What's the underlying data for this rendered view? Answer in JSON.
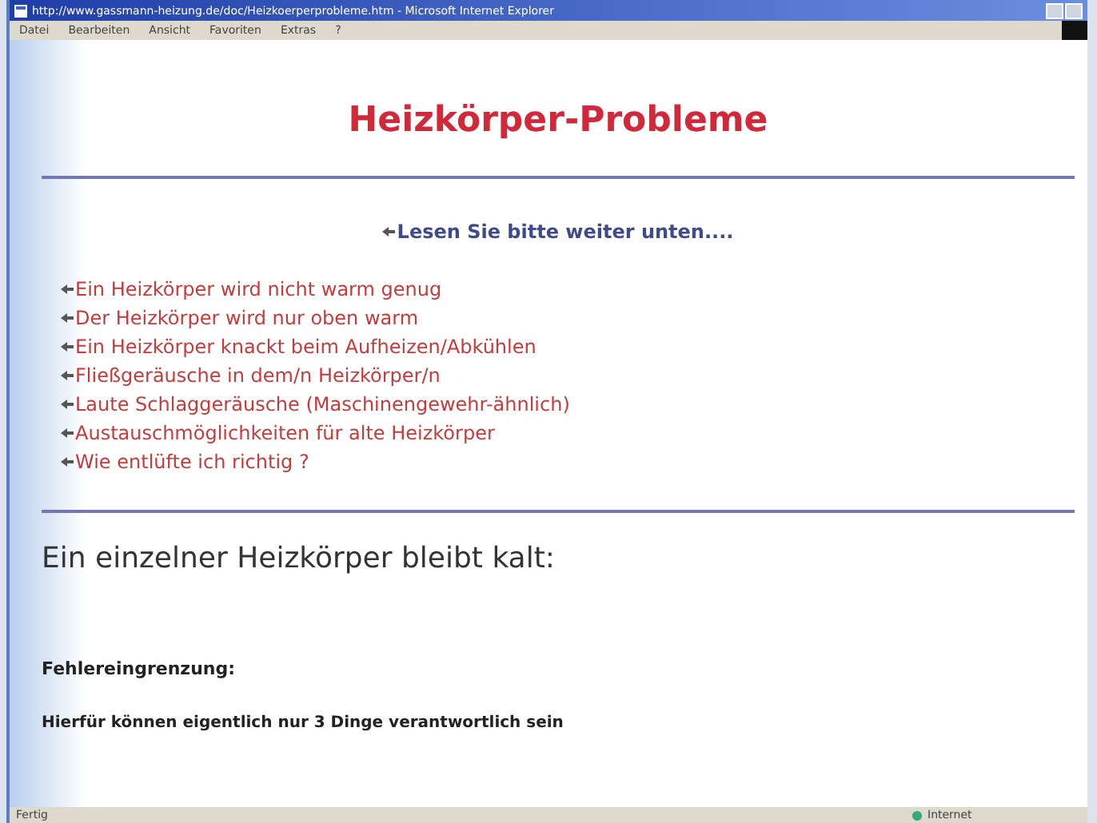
{
  "window": {
    "title": "http://www.gassmann-heizung.de/doc/Heizkoerperprobleme.htm - Microsoft Internet Explorer"
  },
  "menu": [
    "Datei",
    "Bearbeiten",
    "Ansicht",
    "Favoriten",
    "Extras",
    "?"
  ],
  "page": {
    "heading": "Heizkörper-Probleme",
    "intro": "Lesen Sie bitte weiter unten....",
    "links": [
      "Ein Heizkörper wird nicht warm genug",
      "Der Heizkörper wird nur oben warm",
      "Ein Heizkörper knackt beim Aufheizen/Abkühlen",
      "Fließgeräusche in dem/n Heizkörper/n",
      "Laute Schlaggeräusche (Maschinengewehr-ähnlich)",
      "Austauschmöglichkeiten für alte Heizkörper",
      "Wie entlüfte ich richtig ?"
    ],
    "section_heading": "Ein einzelner Heizkörper bleibt kalt:",
    "subheading": "Fehlereingrenzung:",
    "paragraph": "Hierfür können eigentlich nur 3 Dinge verantwortlich sein"
  },
  "status_bar": {
    "status": "Fertig",
    "zone": "Internet"
  }
}
